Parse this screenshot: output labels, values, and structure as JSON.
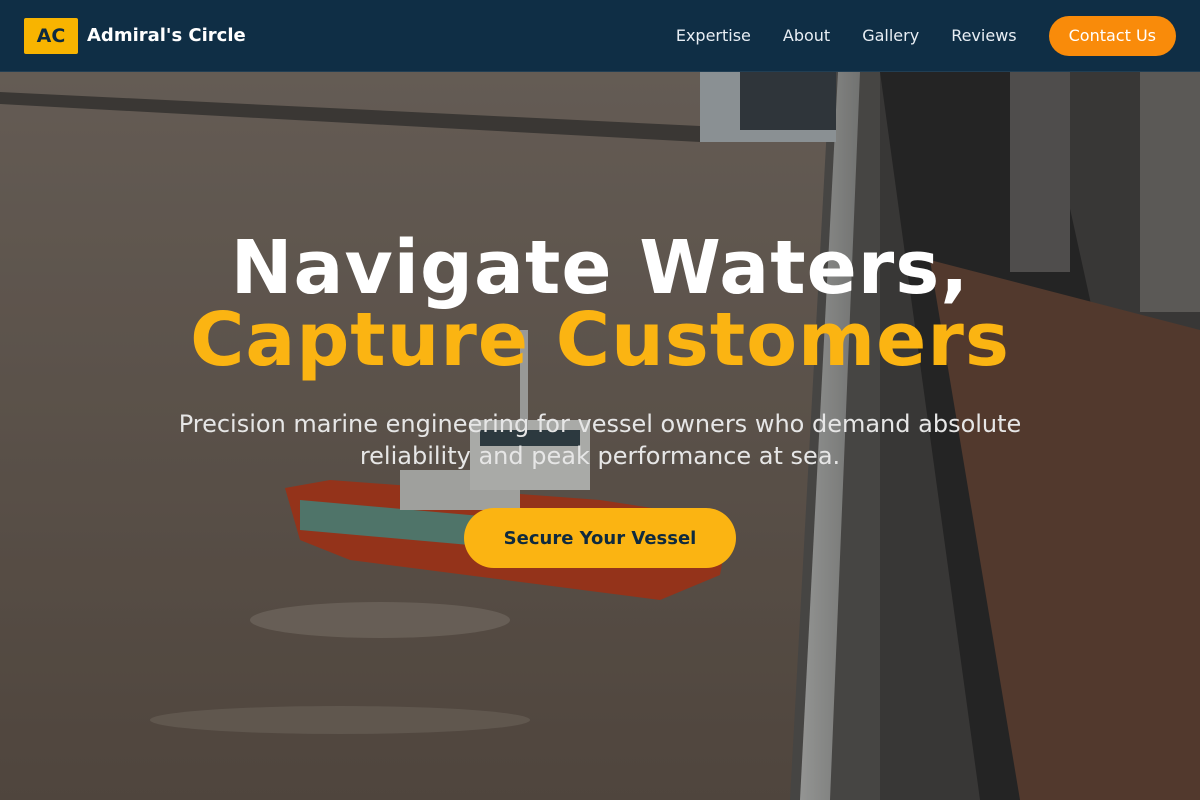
{
  "header": {
    "brand_badge": "AC",
    "brand_name": "Admiral's Circle",
    "nav": [
      {
        "label": "Expertise"
      },
      {
        "label": "About"
      },
      {
        "label": "Gallery"
      },
      {
        "label": "Reviews"
      }
    ],
    "contact_label": "Contact Us"
  },
  "hero": {
    "headline_line1": "Navigate Waters,",
    "headline_line2": "Capture Customers",
    "subtitle": "Precision marine engineering for vessel owners who demand absolute reliability and peak performance at sea.",
    "cta_label": "Secure Your Vessel"
  },
  "colors": {
    "header_bg": "#0a2c44",
    "accent_yellow": "#fbb412",
    "contact_orange": "#f98b0a"
  }
}
